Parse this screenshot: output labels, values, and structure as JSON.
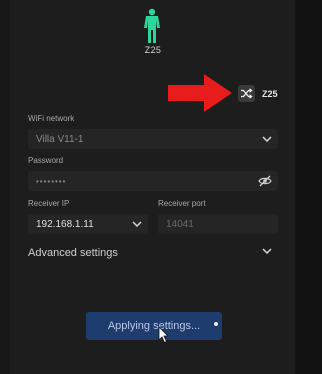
{
  "sensor": {
    "avatar_label": "Z25",
    "id_label": "Z25",
    "figure_color": "#2ed59a",
    "switch_icon": "shuffle-icon"
  },
  "annotation": {
    "arrow_color": "#e81c1c"
  },
  "form": {
    "wifi_label": "WiFi network",
    "wifi_value": "Villa V11-1",
    "password_label": "Password",
    "password_value": "••••••••",
    "receiver_ip_label": "Receiver IP",
    "receiver_ip_value": "192.168.1.11",
    "receiver_port_label": "Receiver port",
    "receiver_port_placeholder": "14041",
    "advanced_label": "Advanced settings"
  },
  "actions": {
    "apply_label": "Applying settings...",
    "apply_color": "#1f3c6e"
  }
}
